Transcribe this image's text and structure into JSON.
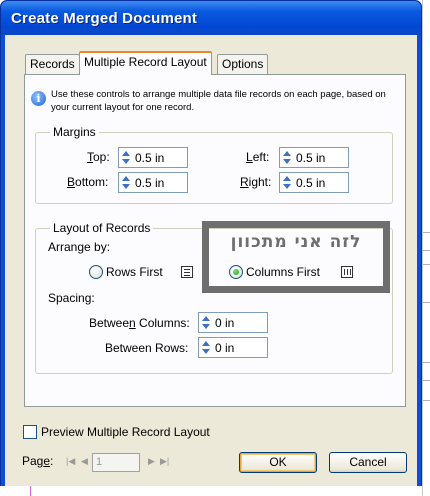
{
  "window": {
    "title": "Create Merged Document"
  },
  "tabs": [
    {
      "label": "Records"
    },
    {
      "label": "Multiple Record Layout"
    },
    {
      "label": "Options"
    }
  ],
  "info": {
    "text": "Use these controls to arrange multiple data file records on each page, based on your current layout for one record."
  },
  "margins": {
    "legend": "Margins",
    "top": {
      "label_u": "T",
      "label_rest": "op:",
      "value": "0.5 in"
    },
    "bottom": {
      "label_u": "B",
      "label_rest": "ottom:",
      "value": "0.5 in"
    },
    "left": {
      "label_u": "L",
      "label_rest": "eft:",
      "value": "0.5 in"
    },
    "right": {
      "label_u": "R",
      "label_rest": "ight:",
      "value": "0.5 in"
    }
  },
  "layout": {
    "legend": "Layout of Records",
    "arrange_by": "Arrange by:",
    "rows_first": "Rows First",
    "columns_first": "Columns First",
    "selected": "columns_first",
    "spacing": "Spacing:",
    "between_columns": {
      "pre": "Betwee",
      "u": "n",
      "post": " Columns:",
      "value": "0 in"
    },
    "between_rows": {
      "label": "Between Rows:",
      "value": "0 in"
    }
  },
  "annotation": {
    "text": "לזה אני מתכוון",
    "color": "#6e6e6e"
  },
  "preview": {
    "label": "Preview Multiple Record Layout",
    "checked": false
  },
  "page": {
    "label_pre": "Pag",
    "label_u": "e",
    "label_post": ":",
    "value": "1"
  },
  "buttons": {
    "ok": "OK",
    "cancel": "Cancel"
  },
  "colors": {
    "titlebar": "#0a5ae0",
    "dialog": "#ece9d8",
    "tab_accent": "#e68b2c"
  }
}
